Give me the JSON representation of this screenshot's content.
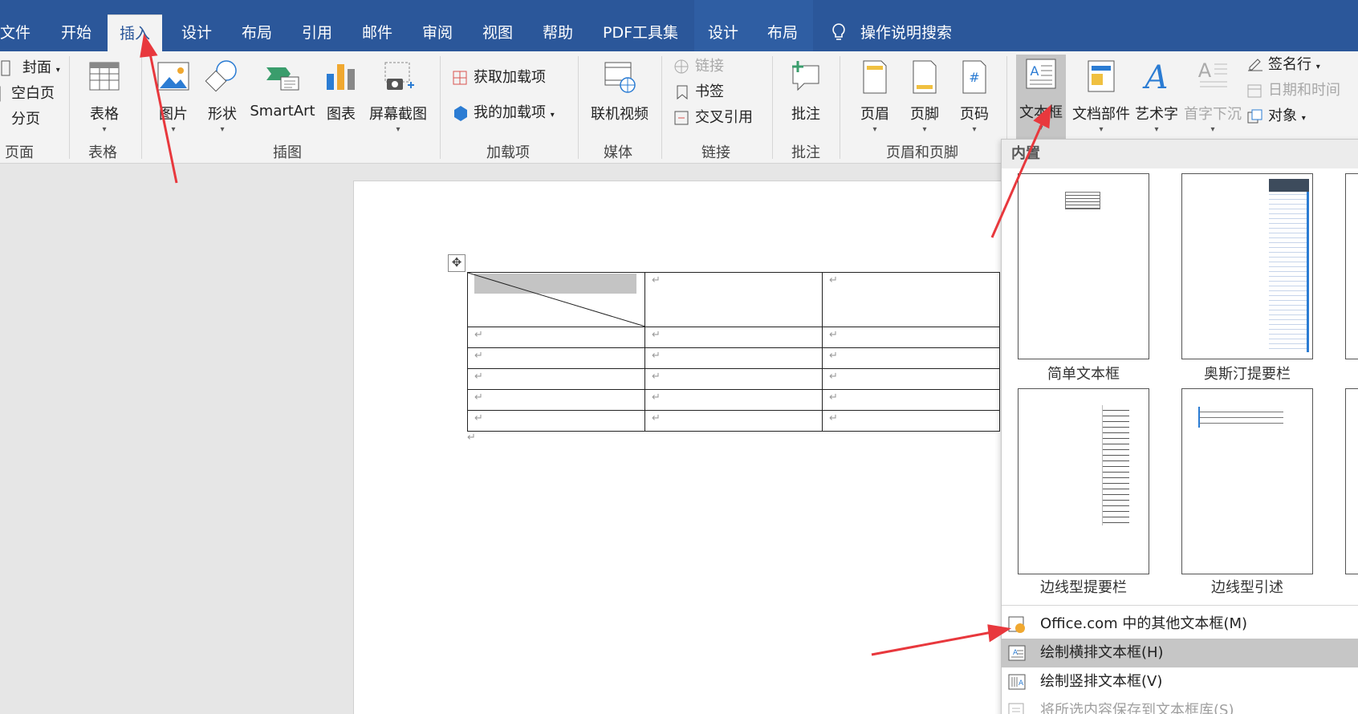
{
  "tabs": {
    "file": "文件",
    "home": "开始",
    "insert": "插入",
    "design": "设计",
    "layout": "布局",
    "references": "引用",
    "mailings": "邮件",
    "review": "审阅",
    "view": "视图",
    "help": "帮助",
    "pdf": "PDF工具集",
    "table_design": "设计",
    "table_layout": "布局",
    "tell_me": "操作说明搜索"
  },
  "ribbon": {
    "pages": {
      "cover": "封面",
      "blank": "空白页",
      "break": "分页",
      "group": "页面"
    },
    "tables": {
      "table": "表格",
      "group": "表格"
    },
    "illustrations": {
      "picture": "图片",
      "shapes": "形状",
      "smartart": "SmartArt",
      "chart": "图表",
      "screenshot": "屏幕截图",
      "group": "插图"
    },
    "addins": {
      "get": "获取加载项",
      "my": "我的加载项",
      "group": "加载项"
    },
    "media": {
      "online_video": "联机视频",
      "group": "媒体"
    },
    "links": {
      "link": "链接",
      "bookmark": "书签",
      "cross_ref": "交叉引用",
      "group": "链接"
    },
    "comments": {
      "comment": "批注",
      "group": "批注"
    },
    "header_footer": {
      "header": "页眉",
      "footer": "页脚",
      "page_number": "页码",
      "group": "页眉和页脚"
    },
    "text": {
      "textbox": "文本框",
      "quick_parts": "文档部件",
      "wordart": "艺术字",
      "dropcap": "首字下沉",
      "signature": "签名行",
      "datetime": "日期和时间",
      "object": "对象"
    }
  },
  "document": {
    "table_rows": [
      [
        "↵",
        "↵",
        "↵"
      ],
      [
        "↵",
        "↵",
        "↵"
      ],
      [
        "↵",
        "↵",
        "↵"
      ],
      [
        "↵",
        "↵",
        "↵"
      ],
      [
        "↵",
        "↵",
        "↵"
      ],
      [
        "↵",
        "↵",
        "↵"
      ]
    ],
    "paragraph_mark": "↵",
    "move_handle": "✥"
  },
  "textbox_menu": {
    "header": "内置",
    "gallery": [
      {
        "name": "简单文本框"
      },
      {
        "name": "奥斯汀提要栏"
      },
      {
        "name": "边线型提要栏"
      },
      {
        "name": "边线型引述"
      }
    ],
    "items": {
      "more": "Office.com 中的其他文本框(M)",
      "draw": "绘制横排文本框(H)",
      "vertical": "绘制竖排文本框(V)",
      "save": "将所选内容保存到文本框库(S)"
    }
  },
  "colors": {
    "accent": "#2b579a",
    "arrow": "#e8383d",
    "highlight": "#c6c6c6"
  }
}
